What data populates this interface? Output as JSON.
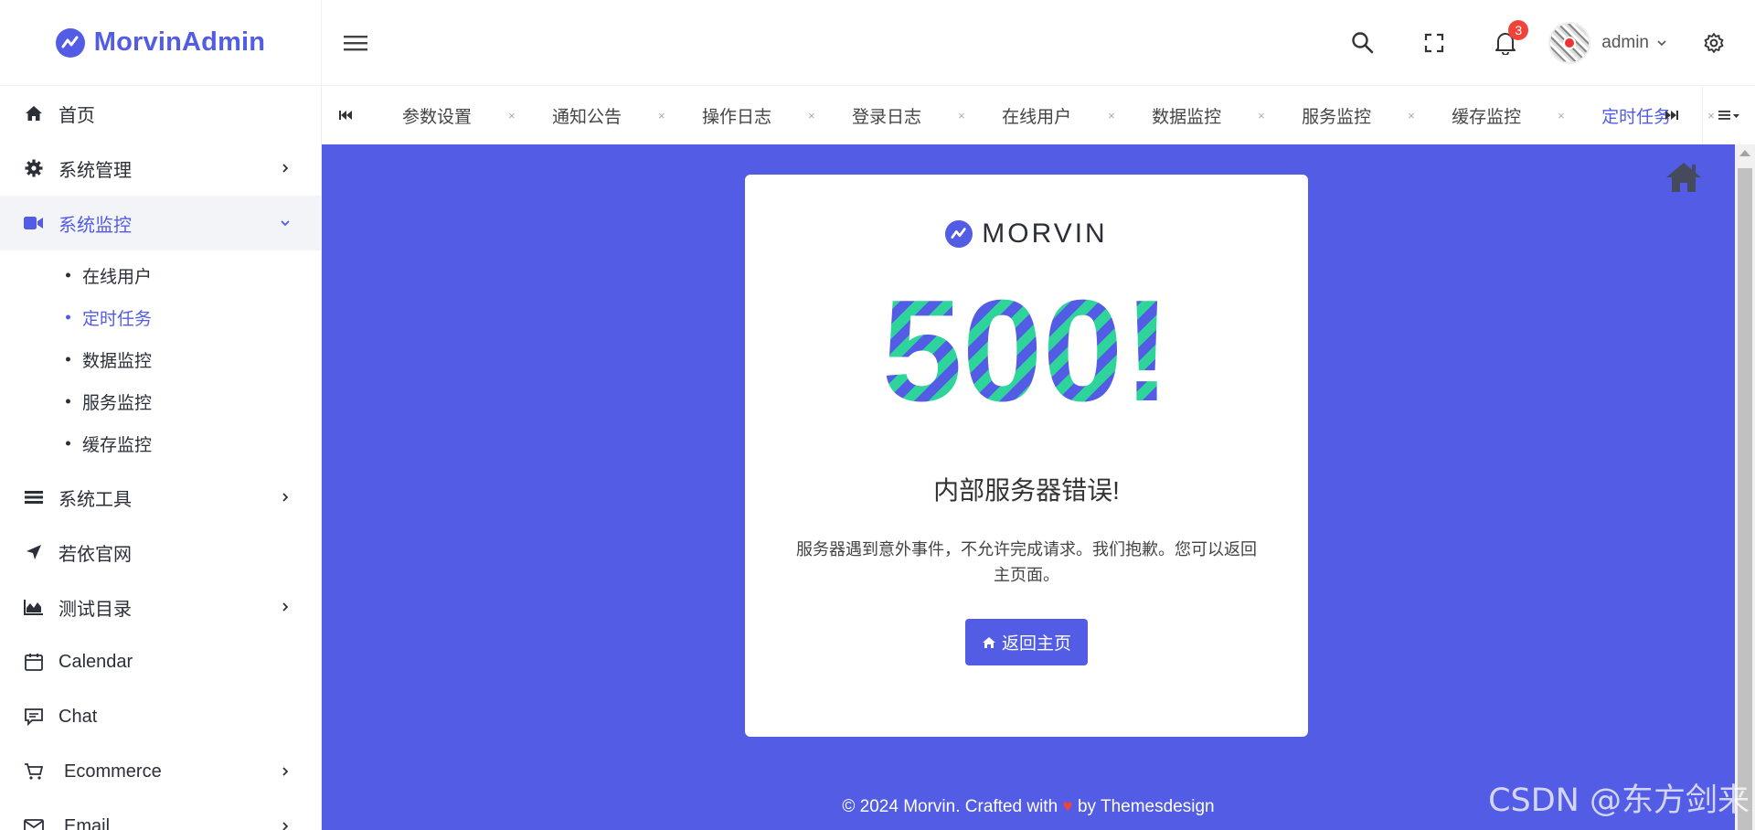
{
  "brand": {
    "name": "MorvinAdmin"
  },
  "sidebar": {
    "items": [
      {
        "label": "首页",
        "icon": "home-icon"
      },
      {
        "label": "系统管理",
        "icon": "gear-icon"
      },
      {
        "label": "系统监控",
        "icon": "video-icon",
        "expanded": true
      },
      {
        "label": "系统工具",
        "icon": "bars-icon"
      },
      {
        "label": "若依官网",
        "icon": "location-arrow-icon"
      },
      {
        "label": "测试目录",
        "icon": "area-chart-icon"
      },
      {
        "label": "Calendar",
        "icon": "calendar-icon"
      },
      {
        "label": "Chat",
        "icon": "chat-icon"
      },
      {
        "label": "Ecommerce",
        "icon": "cart-icon"
      },
      {
        "label": "Email",
        "icon": "mail-icon"
      }
    ],
    "submenu": [
      "在线用户",
      "定时任务",
      "数据监控",
      "服务监控",
      "缓存监控"
    ],
    "active_submenu": "定时任务"
  },
  "header": {
    "notification_count": "3",
    "username": "admin"
  },
  "tabs": {
    "items": [
      "参数设置",
      "通知公告",
      "操作日志",
      "登录日志",
      "在线用户",
      "数据监控",
      "服务监控",
      "缓存监控",
      "定时任务"
    ],
    "active": "定时任务",
    "close_glyph": "×"
  },
  "error_page": {
    "brand": "MORVIN",
    "code": "500!",
    "title": "内部服务器错误!",
    "description": "服务器遇到意外事件，不允许完成请求。我们抱歉。您可以返回主页面。",
    "button_label": "返回主页"
  },
  "footer": {
    "prefix": "© 2024 Morvin. Crafted with",
    "heart": "♥",
    "suffix": "by Themesdesign"
  },
  "watermark": "CSDN @东方剑来",
  "colors": {
    "accent": "#525ce5",
    "green_stripe": "#2fd49a",
    "badge": "#f0443a"
  }
}
